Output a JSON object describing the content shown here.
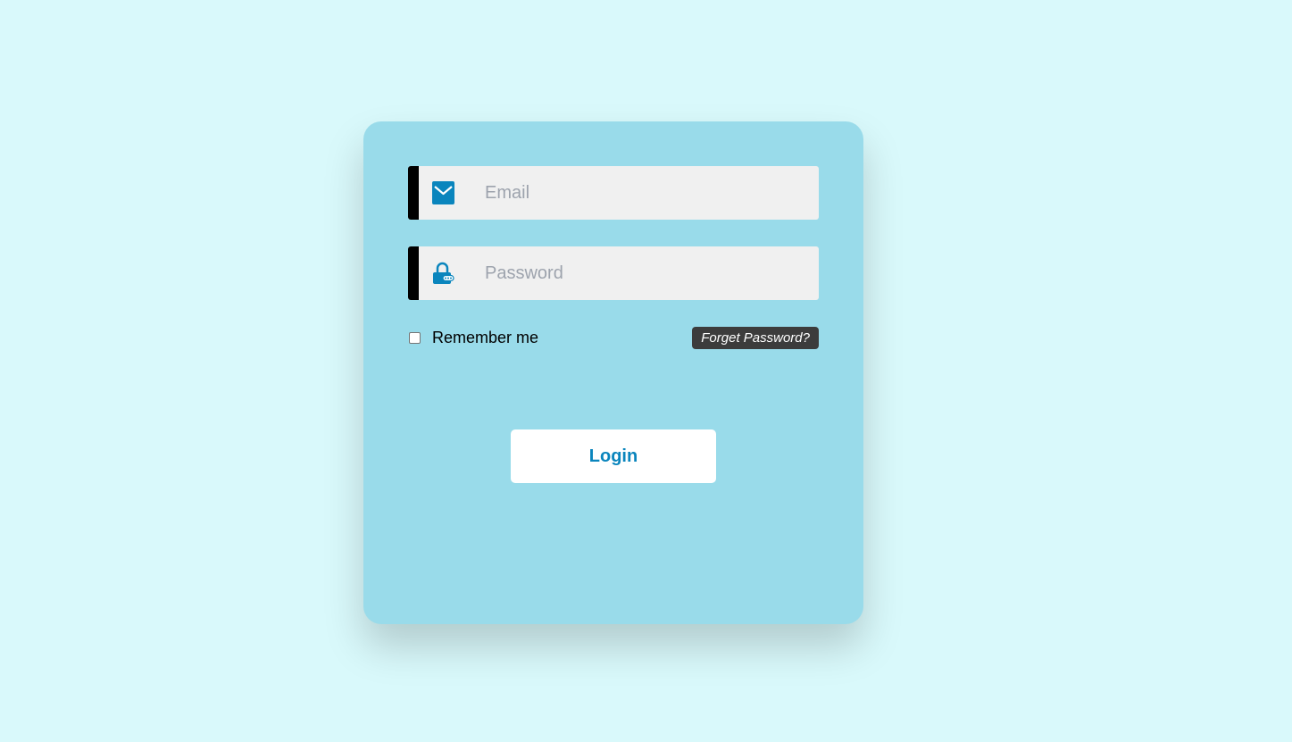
{
  "login_form": {
    "email": {
      "placeholder": "Email",
      "value": "",
      "icon": "envelope-icon"
    },
    "password": {
      "placeholder": "Password",
      "value": "",
      "icon": "lock-icon"
    },
    "remember_me": {
      "label": "Remember me",
      "checked": false
    },
    "forgot_password_label": "Forget Password?",
    "login_label": "Login"
  },
  "colors": {
    "page_background": "#d9f9fb",
    "card_background": "#99dbea",
    "accent": "#0a85bd",
    "field_background": "#f0f0f0",
    "forgot_badge": "#3c3c3c"
  }
}
